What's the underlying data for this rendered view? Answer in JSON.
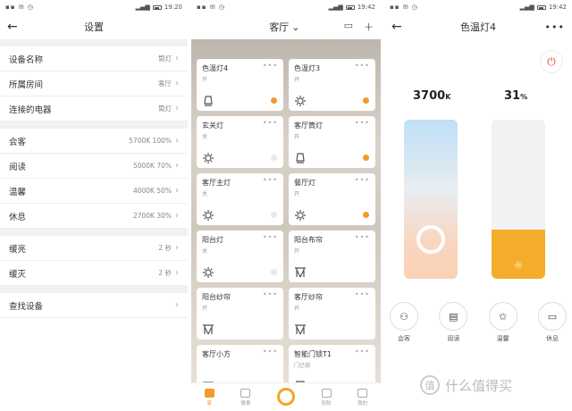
{
  "status_bar": {
    "p1_time": "19:20",
    "p2_time": "19:42",
    "p3_time": "19:42"
  },
  "settings": {
    "title": "设置",
    "group1": [
      {
        "label": "设备名称",
        "value": "筒灯"
      },
      {
        "label": "所属房间",
        "value": "客厅"
      },
      {
        "label": "连接的电器",
        "value": "筒灯"
      }
    ],
    "group2": [
      {
        "label": "会客",
        "value": "5700K 100%"
      },
      {
        "label": "阅读",
        "value": "5000K 70%"
      },
      {
        "label": "温馨",
        "value": "4000K 50%"
      },
      {
        "label": "休息",
        "value": "2700K 30%"
      }
    ],
    "group3": [
      {
        "label": "缓亮",
        "value": "2 秒"
      },
      {
        "label": "缓灭",
        "value": "2 秒"
      }
    ],
    "group4": [
      {
        "label": "查找设备",
        "value": ""
      }
    ]
  },
  "home": {
    "room": "客厅",
    "devices": [
      {
        "name": "色温灯4",
        "state": "开",
        "icon": "downlight-icon",
        "on": true
      },
      {
        "name": "色温灯3",
        "state": "开",
        "icon": "bulb-icon",
        "on": true
      },
      {
        "name": "玄关灯",
        "state": "关",
        "icon": "bulb-icon",
        "on": false
      },
      {
        "name": "客厅筒灯",
        "state": "开",
        "icon": "downlight-icon",
        "on": true
      },
      {
        "name": "客厅主灯",
        "state": "关",
        "icon": "bulb-icon",
        "on": false
      },
      {
        "name": "餐厅灯",
        "state": "开",
        "icon": "bulb-icon",
        "on": true
      },
      {
        "name": "阳台灯",
        "state": "关",
        "icon": "bulb-icon",
        "on": false
      },
      {
        "name": "阳台布帘",
        "state": "开",
        "icon": "curtain-icon",
        "on": null
      },
      {
        "name": "阳台纱帘",
        "state": "开",
        "icon": "curtain-icon",
        "on": null
      },
      {
        "name": "客厅纱帘",
        "state": "开",
        "icon": "curtain-icon",
        "on": null
      },
      {
        "name": "客厅小方",
        "state": "",
        "icon": "speaker-icon",
        "on": null
      },
      {
        "name": "智能门锁T1",
        "state": "门已锁",
        "icon": "lock-icon",
        "on": null
      }
    ],
    "tabs": [
      {
        "label": "家",
        "active": true
      },
      {
        "label": "情景",
        "active": false
      },
      {
        "label": "",
        "active": false
      },
      {
        "label": "安防",
        "active": false
      },
      {
        "label": "我的",
        "active": false
      }
    ]
  },
  "lamp": {
    "title": "色温灯4",
    "temperature_value": "3700",
    "temperature_unit": "K",
    "brightness_value": "31",
    "brightness_unit": "%",
    "brightness_level": 0.31,
    "scenes": [
      {
        "label": "会客",
        "icon": "guests-icon"
      },
      {
        "label": "阅读",
        "icon": "book-icon"
      },
      {
        "label": "温馨",
        "icon": "stars-icon"
      },
      {
        "label": "休息",
        "icon": "bed-icon"
      }
    ],
    "accent": "#f4ac2a",
    "power_color": "#e8462e"
  },
  "watermark": {
    "text": "什么值得买",
    "mark": "值"
  }
}
